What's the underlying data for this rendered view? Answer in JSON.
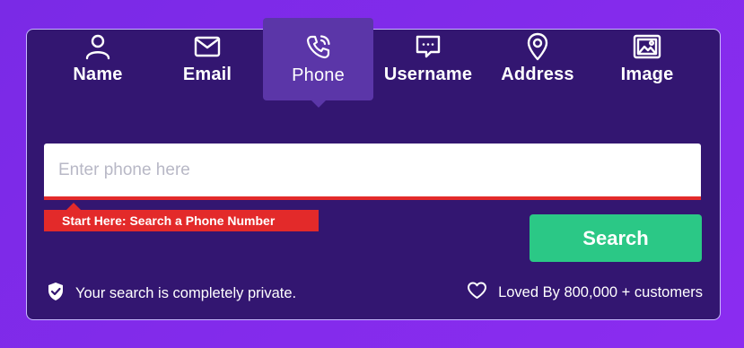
{
  "tabs": [
    {
      "label": "Name",
      "icon": "user-icon",
      "active": false
    },
    {
      "label": "Email",
      "icon": "envelope-icon",
      "active": false
    },
    {
      "label": "Phone",
      "icon": "phone-icon",
      "active": true
    },
    {
      "label": "Username",
      "icon": "chat-bubble-icon",
      "active": false
    },
    {
      "label": "Address",
      "icon": "location-pin-icon",
      "active": false
    },
    {
      "label": "Image",
      "icon": "image-icon",
      "active": false
    }
  ],
  "search": {
    "placeholder": "Enter phone here",
    "value": "",
    "hint": "Start Here: Search a Phone Number",
    "button_label": "Search"
  },
  "footer": {
    "privacy_text": "Your search is completely private.",
    "loved_text": "Loved By 800,000 + customers"
  },
  "colors": {
    "background": "#8b2cf0",
    "card": "#331671",
    "active_tab": "#5b36a8",
    "accent_red": "#e32a2a",
    "button_green": "#2bc886"
  }
}
